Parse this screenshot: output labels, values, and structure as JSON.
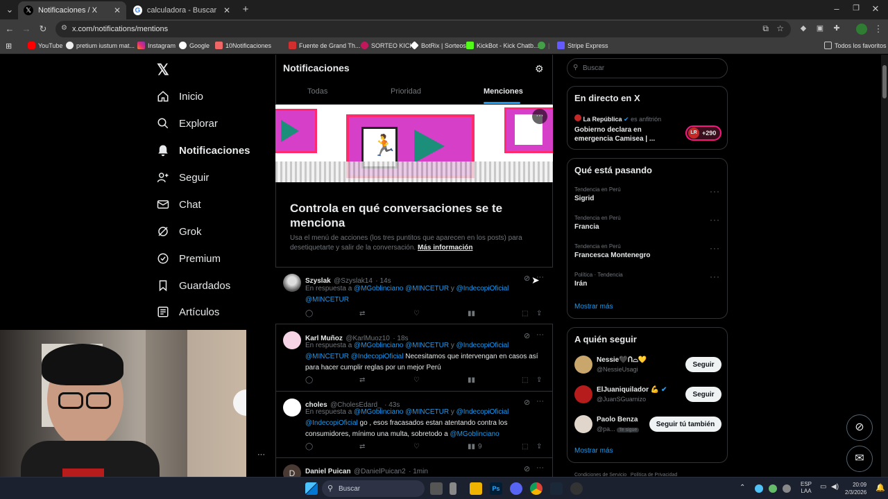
{
  "browser": {
    "tabs": [
      {
        "title": "Notificaciones / X",
        "active": true
      },
      {
        "title": "calculadora - Buscar con Googl",
        "active": false
      }
    ],
    "url": "x.com/notifications/mentions",
    "bookmarks": [
      "YouTube",
      "pretium iustum mat...",
      "Instagram",
      "Google",
      "10Notificaciones",
      "Fuente de Grand Th...",
      "SORTEO KICK",
      "BotRix | Sorteos",
      "KickBot - Kick Chatb...",
      "Stripe Express"
    ],
    "all_bookmarks": "Todos los favoritos"
  },
  "nav": {
    "items": [
      {
        "label": "Inicio",
        "icon": "home-icon"
      },
      {
        "label": "Explorar",
        "icon": "search-icon"
      },
      {
        "label": "Notificaciones",
        "icon": "bell-icon"
      },
      {
        "label": "Seguir",
        "icon": "add-person-icon"
      },
      {
        "label": "Chat",
        "icon": "mail-icon"
      },
      {
        "label": "Grok",
        "icon": "grok-icon"
      },
      {
        "label": "Premium",
        "icon": "premium-icon"
      },
      {
        "label": "Guardados",
        "icon": "bookmark-icon"
      },
      {
        "label": "Artículos",
        "icon": "articles-icon"
      }
    ]
  },
  "main": {
    "title": "Notificaciones",
    "tabs": [
      "Todas",
      "Prioridad",
      "Menciones"
    ],
    "banner": {
      "heading": "Controla en qué conversaciones se te menciona",
      "body": "Usa el menú de acciones (los tres puntitos que aparecen en los posts) para desetiquetarte y salir de la conversación.",
      "link": "Más información"
    },
    "reply_prefix": "En respuesta a",
    "y": "y",
    "posts": [
      {
        "name": "Szyslak",
        "handle": "@Szyslak14",
        "time": "· 14s",
        "mentions": [
          "@MGoblinciano",
          "@MINCETUR",
          "@IndecopiOficial",
          "@MINCETUR"
        ],
        "text": "",
        "views": ""
      },
      {
        "name": "Karl Muñoz",
        "handle": "@KarlMuoz10",
        "time": "· 18s",
        "mentions": [
          "@MGoblinciano",
          "@MINCETUR",
          "@IndecopiOficial",
          "@MINCETUR",
          "@IndecopiOficial"
        ],
        "text": "Necesitamos que intervengan en casos así para hacer cumplir reglas por un mejor Perú",
        "views": ""
      },
      {
        "name": "choles",
        "handle": "@CholesEdard_",
        "time": "· 43s",
        "mentions": [
          "@MGoblinciano",
          "@MINCETUR",
          "@IndecopiOficial",
          "@IndecopiOficial",
          "@MGoblinciano"
        ],
        "text": " go , esos fracasados estan atentando contra los consumidores, mínimo una multa, sobretodo a",
        "views": "9"
      },
      {
        "name": "Daniel Puican",
        "handle": "@DanielPuican2",
        "time": "· 1min",
        "mentions": [],
        "text": "",
        "views": ""
      }
    ]
  },
  "right": {
    "search_placeholder": "Buscar",
    "live": {
      "title": "En directo en X",
      "host": "La República",
      "host_role": "es anfitrión",
      "headline": "Gobierno declara en emergencia Camisea | ...",
      "badge": "+290",
      "logo_text": "LR"
    },
    "trending": {
      "title": "Qué está pasando",
      "items": [
        {
          "meta": "Tendencia en Perú",
          "name": "Sigrid"
        },
        {
          "meta": "Tendencia en Perú",
          "name": "Francia"
        },
        {
          "meta": "Tendencia en Perú",
          "name": "Francesca Montenegro"
        },
        {
          "meta": "Política · Tendencia",
          "name": "Irán"
        }
      ],
      "more": "Mostrar más"
    },
    "follow": {
      "title": "A quién seguir",
      "items": [
        {
          "name": "Nessie🖤ᑎ⌓💛",
          "handle": "@NessieUsagi",
          "button": "Seguir",
          "badge": ""
        },
        {
          "name": "ElJuaniquilador 💪",
          "handle": "@JuanSGuarnizo",
          "button": "Seguir",
          "badge": ""
        },
        {
          "name": "Paolo Benza",
          "handle": "@pa...",
          "button": "Seguir tú también",
          "badge": "Te sigue"
        }
      ],
      "more": "Mostrar más"
    },
    "footer": "Condiciones de Servicio   Política de Privacidad"
  },
  "taskbar": {
    "search": "Buscar",
    "lang": "ESP",
    "lang2": "LAA",
    "time": "20:09",
    "date": "2/3/2026"
  },
  "colors": {
    "accent": "#1d9bf0",
    "bg": "#000000",
    "border": "#2f3336"
  }
}
